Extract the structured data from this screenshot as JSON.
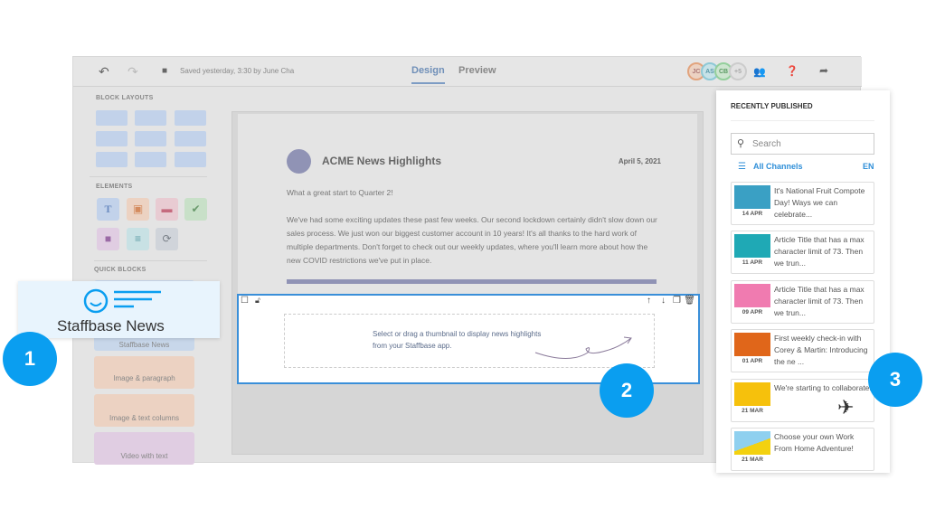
{
  "toolbar": {
    "saved": "Saved yesterday, 3:30 by June Cha",
    "tabs": [
      "Design",
      "Preview"
    ],
    "active_tab": "Design",
    "avatars": [
      "JC",
      "AS",
      "CB",
      "+5"
    ]
  },
  "sidebar": {
    "block_layouts": "BLOCK LAYOUTS",
    "elements": "ELEMENTS",
    "quick_blocks": "QUICK BLOCKS",
    "quick_items": [
      "Staffbase News",
      "Image & paragraph",
      "Image & text columns",
      "Video with text"
    ]
  },
  "email": {
    "title": "ACME News Highlights",
    "date": "April 5, 2021",
    "intro": "What a great start to Quarter 2!",
    "body": "We've had some exciting updates these past few weeks. Our second lockdown certainly didn't slow down our sales process. We just won our biggest customer account in 10 years! It's all thanks to the hard work of multiple departments. Don't forget to check out our weekly updates, where you'll learn more about how the new COVID restrictions we've put in place.",
    "placeholder": "Select or drag a thumbnail to display news highlights from your Staffbase app."
  },
  "panel": {
    "title": "RECENTLY PUBLISHED",
    "search_placeholder": "Search",
    "channels": "All Channels",
    "lang": "EN",
    "items": [
      {
        "date": "14 APR",
        "title": "It's National Fruit Compote Day! Ways we can celebrate..."
      },
      {
        "date": "11 APR",
        "title": "Article Title that has a max character limit of 73. Then we trun..."
      },
      {
        "date": "09 APR",
        "title": "Article Title that has a max character limit of 73. Then we trun..."
      },
      {
        "date": "01 APR",
        "title": "First weekly check-in with Corey & Martin: Introducing the ne ..."
      },
      {
        "date": "21 MAR",
        "title": "We're starting to collaborate!"
      },
      {
        "date": "21 MAR",
        "title": "Choose your own Work From Home Adventure!"
      }
    ]
  },
  "callout": {
    "label": "Staffbase News"
  },
  "badges": [
    "1",
    "2",
    "3"
  ],
  "colors": {
    "accent": "#0a9ef0",
    "link": "#2f8fd8",
    "email_accent": "#9093b5"
  }
}
